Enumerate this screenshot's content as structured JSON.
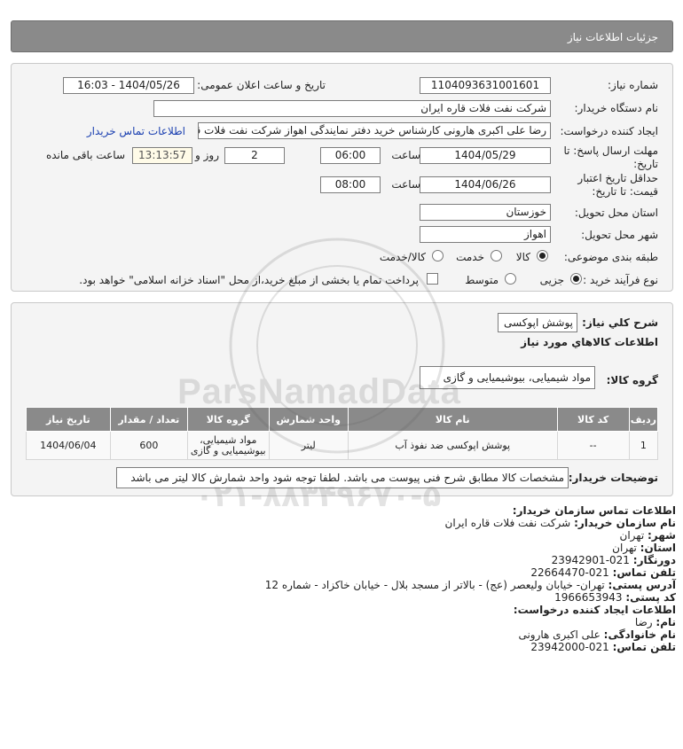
{
  "header": {
    "title": "جزئیات اطلاعات نیاز"
  },
  "form": {
    "need_number_label": "شماره نیاز:",
    "need_number": "1104093631001601",
    "announce_label": "تاریخ و ساعت اعلان عمومی:",
    "announce_value": "1404/05/26 - 16:03",
    "buyer_org_label": "نام دستگاه خریدار:",
    "buyer_org": "شرکت نفت فلات قاره ایران",
    "creator_label": "ایجاد کننده درخواست:",
    "creator": "رضا علی اکبری هارونی کارشناس خرید دفتر نمایندگی اهواز شرکت نفت فلات قاره",
    "contact_link": "اطلاعات تماس خریدار",
    "deadline_label_1": "مهلت ارسال پاسخ: تا",
    "deadline_label_2": "تاریخ:",
    "deadline_date": "1404/05/29",
    "time_label": "ساعت",
    "deadline_time": "06:00",
    "days_count": "2",
    "days_label": "روز و",
    "timer": "13:13:57",
    "remaining_label": "ساعت باقی مانده",
    "validity_label_1": "حداقل تاریخ اعتبار",
    "validity_label_2": "قیمت: تا تاریخ:",
    "validity_date": "1404/06/26",
    "validity_time": "08:00",
    "province_label": "استان محل تحویل:",
    "province": "خوزستان",
    "city_label": "شهر محل تحویل:",
    "city": "اهواز",
    "category_label": "طبقه بندی موضوعی:",
    "category_options": [
      "کالا",
      "خدمت",
      "کالا/خدمت"
    ],
    "category_selected": 0,
    "process_label": "نوع فرآیند خرید :",
    "process_options": [
      "جزیی",
      "متوسط"
    ],
    "process_selected": 0,
    "payment_note": "پرداخت تمام یا بخشی از مبلغ خرید،از محل \"اسناد خزانه اسلامی\" خواهد بود."
  },
  "details": {
    "general_desc_label": "شرح کلي نياز:",
    "general_desc": "پوشش اپوکسی",
    "goods_info_title": "اطلاعات کالاهاي مورد نياز",
    "goods_group_label": "گروه کالا:",
    "goods_group": "مواد شیمیایی، بیوشیمیایی و گازی",
    "table": {
      "headers": [
        "ردیف",
        "کد کالا",
        "نام کالا",
        "واحد شمارش",
        "گروه کالا",
        "تعداد / مقدار",
        "تاریخ نیاز"
      ],
      "rows": [
        [
          "1",
          "--",
          "پوشش اپوکسی ضد نفوذ آب",
          "لیتر",
          "مواد شیمیایی، بیوشیمیایی و گازی",
          "600",
          "1404/06/04"
        ]
      ]
    },
    "buyer_notes_label": "توضیحات خریدار:",
    "buyer_notes": "مشخصات کالا مطابق شرح فنی پیوست می باشد. لطفا توجه شود واحد شمارش کالا لیتر می باشد"
  },
  "watermark": {
    "brand": "ParsNamadData",
    "phone": "۰۲۱-۸۸۳۴۹۶۷۰-۵"
  },
  "contact": {
    "section_title": "اطلاعات تماس سازمان خریدار:",
    "lines": [
      {
        "k": "نام سازمان خریدار:",
        "v": "شرکت نفت فلات قاره ایران"
      },
      {
        "k": "شهر:",
        "v": "تهران"
      },
      {
        "k": "استان:",
        "v": "تهران"
      },
      {
        "k": "دورنگار:",
        "v": "021-23942901"
      },
      {
        "k": "تلفن تماس:",
        "v": "021-22664470"
      },
      {
        "k": "آدرس پستی:",
        "v": "تهران- خیابان ولیعصر (عج) - بالاتر از مسجد بلال - خیابان خاکزاد - شماره 12"
      },
      {
        "k": "کد پستی:",
        "v": "1966653943"
      }
    ],
    "creator_title": "اطلاعات ایجاد کننده درخواست:",
    "creator_lines": [
      {
        "k": "نام:",
        "v": "رضا"
      },
      {
        "k": "نام خانوادگی:",
        "v": "علی اکبری هارونی"
      },
      {
        "k": "تلفن تماس:",
        "v": "021-23942000"
      }
    ]
  }
}
